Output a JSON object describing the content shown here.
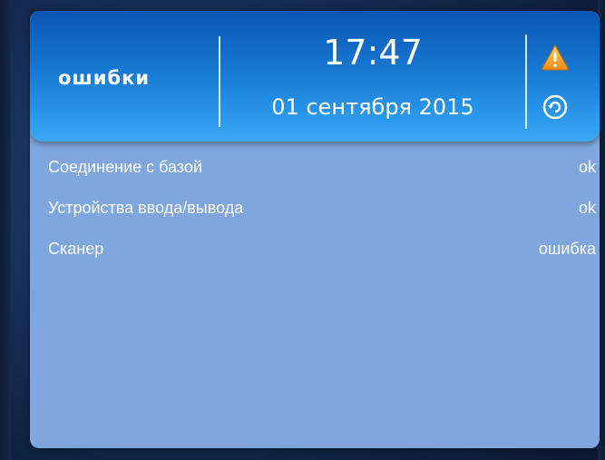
{
  "header": {
    "title": "ошибки",
    "time": "17:47",
    "date": "01 сентября 2015"
  },
  "icons": {
    "warning": "warning-triangle-icon",
    "refresh": "refresh-icon",
    "warning_color": "#f5a623",
    "refresh_color": "#ffffff"
  },
  "status_list": [
    {
      "label": "Соединение с базой",
      "value": "ok"
    },
    {
      "label": "Устройства ввода/вывода",
      "value": "ok"
    },
    {
      "label": "Сканер",
      "value": "ошибка"
    }
  ],
  "colors": {
    "panel_background": "#7fa6de",
    "header_top": "#0a56b4",
    "header_bottom": "#3aa8f3",
    "desktop_background": "#13294d"
  }
}
